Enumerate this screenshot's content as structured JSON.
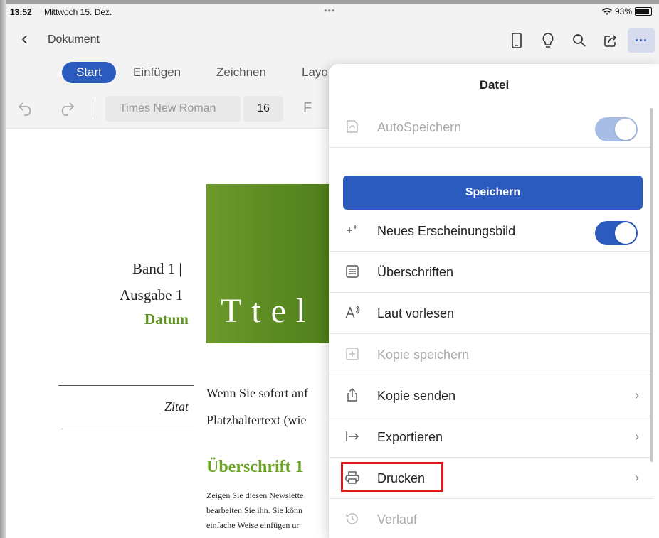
{
  "status": {
    "time": "13:52",
    "date": "Mittwoch 15. Dez.",
    "dots": "•••",
    "battery": "93%"
  },
  "nav": {
    "back_glyph": "‹",
    "title": "Dokument",
    "more_glyph": "···"
  },
  "tabs": [
    "Start",
    "Einfügen",
    "Zeichnen",
    "Layo"
  ],
  "toolbar": {
    "font": "Times New Roman",
    "size": "16",
    "bold": "F"
  },
  "document": {
    "title": "Ttel",
    "band": "Band 1 |",
    "ausgabe": "Ausgabe 1",
    "datum": "Datum",
    "zitat": "Zitat",
    "body1": "Wenn Sie sofort anf",
    "body2": "Platzhaltertext (wie",
    "heading1": "Überschrift 1",
    "small1": "Zeigen Sie diesen Newslette",
    "small2": "bearbeiten Sie ihn. Sie könn",
    "small3": "einfache Weise einfügen ur"
  },
  "panel": {
    "title": "Datei",
    "autosave": "AutoSpeichern",
    "save": "Speichern",
    "items": [
      {
        "label": "Neues Erscheinungsbild"
      },
      {
        "label": "Überschriften"
      },
      {
        "label": "Laut vorlesen"
      },
      {
        "label": "Kopie speichern"
      },
      {
        "label": "Kopie senden"
      },
      {
        "label": "Exportieren"
      },
      {
        "label": "Drucken"
      },
      {
        "label": "Verlauf"
      }
    ],
    "chevron": "›"
  },
  "colors": {
    "accent": "#2b5bbf",
    "highlight": "#e3161c",
    "green": "#5f9422"
  }
}
